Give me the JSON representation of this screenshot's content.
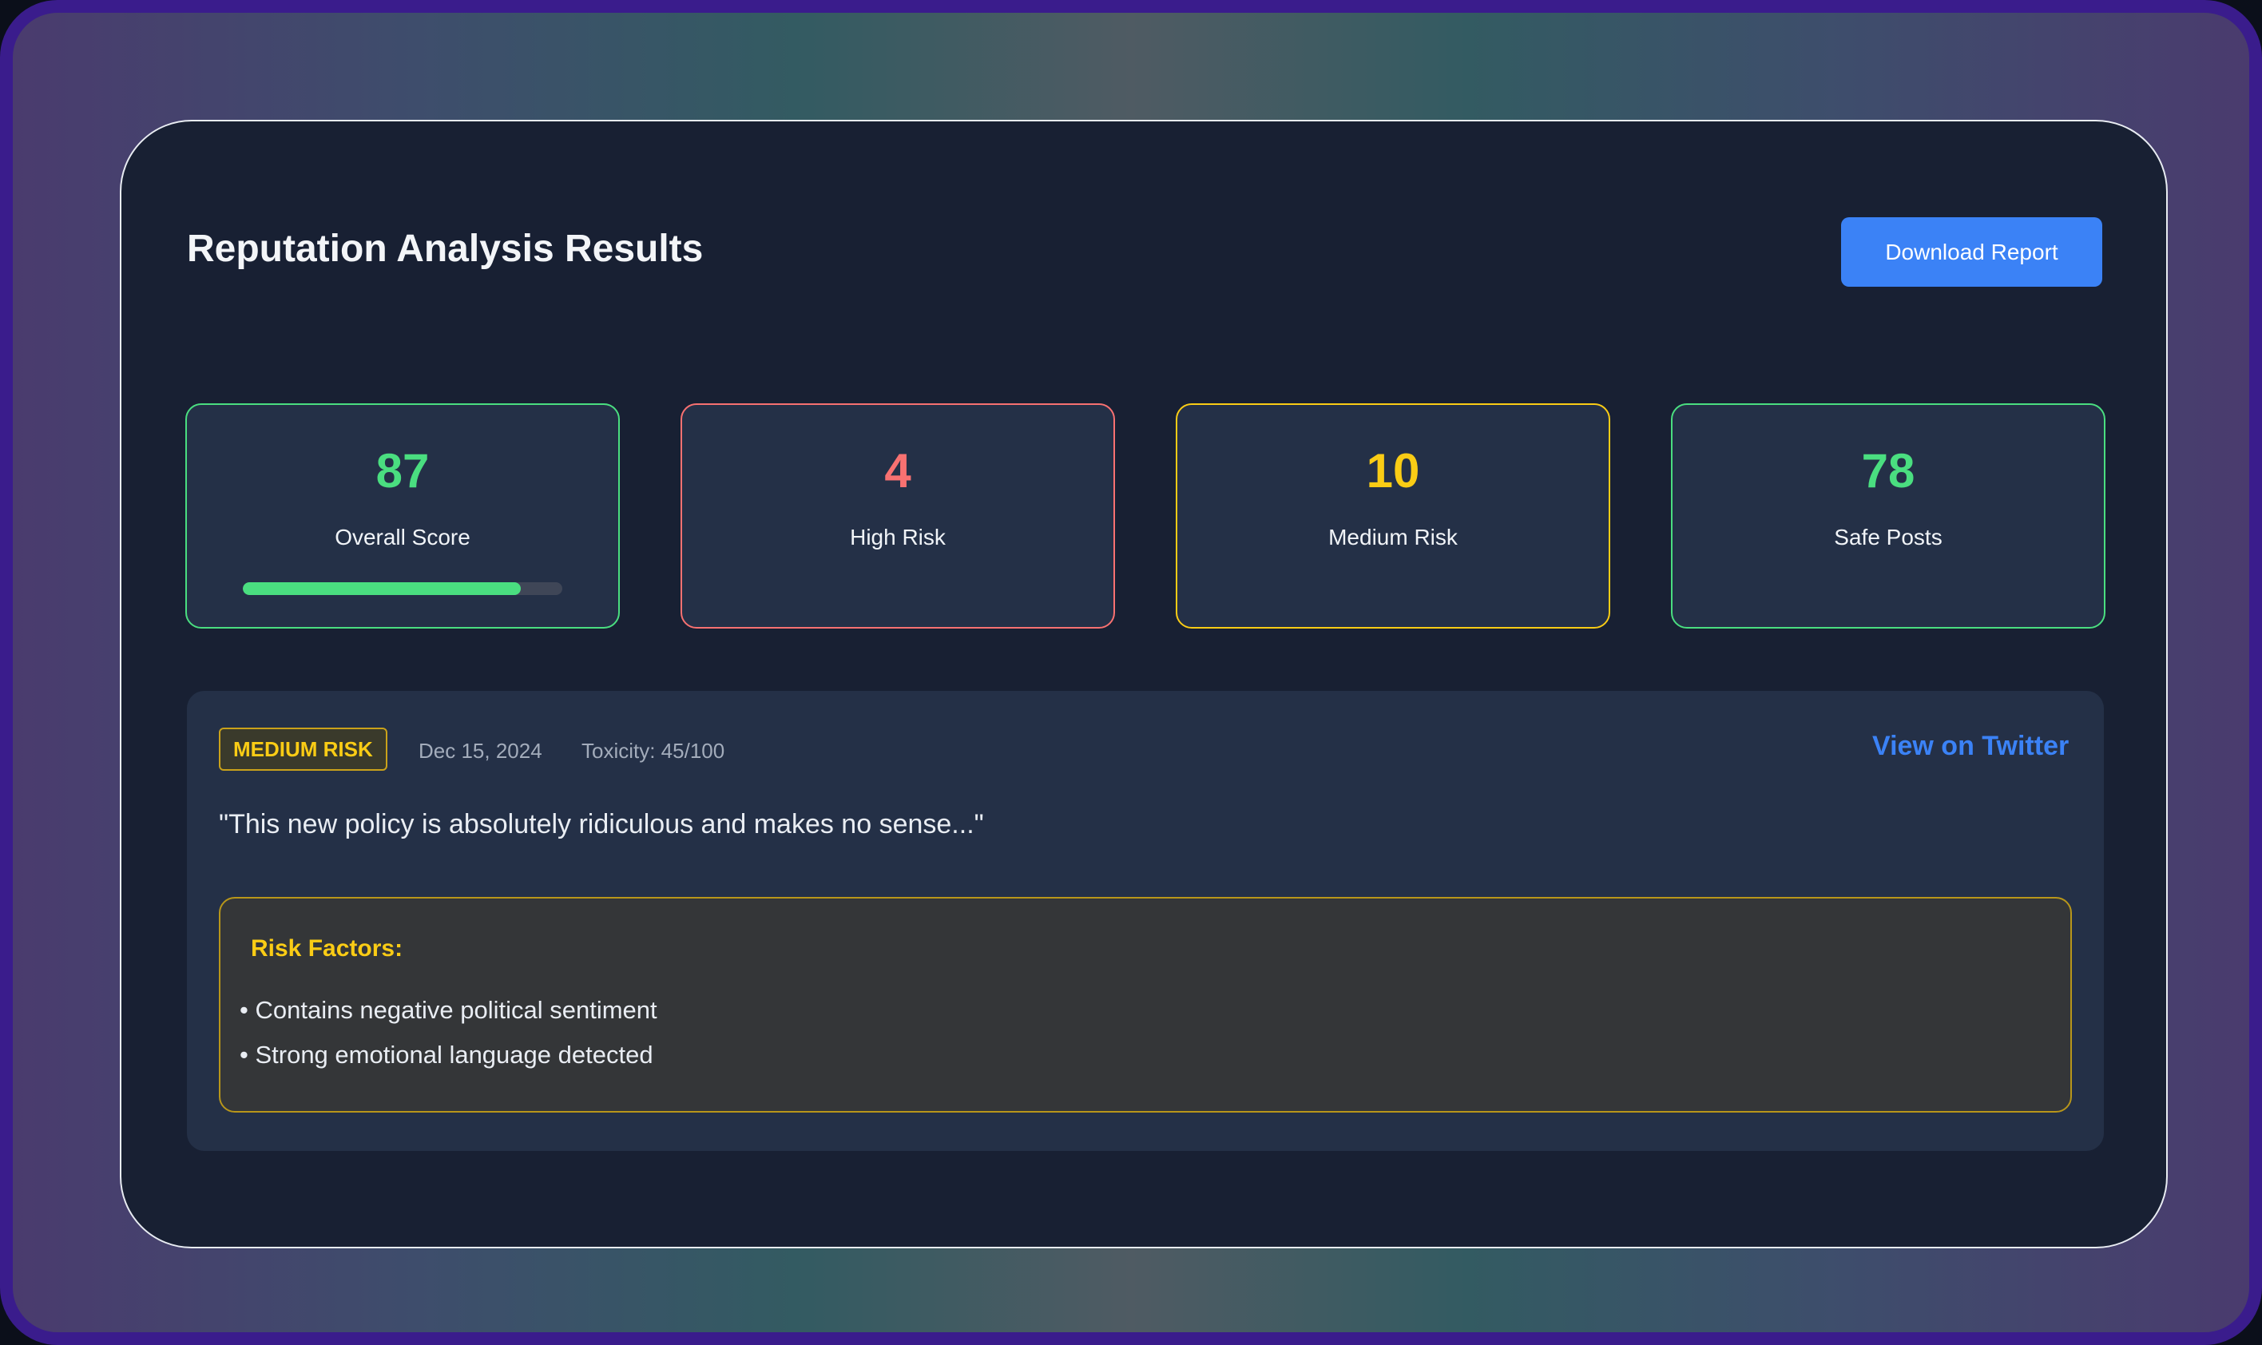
{
  "header": {
    "title": "Reputation Analysis Results",
    "download_label": "Download Report"
  },
  "stats": {
    "overall": {
      "value": "87",
      "label": "Overall Score",
      "progress_percent": 87
    },
    "high": {
      "value": "4",
      "label": "High Risk"
    },
    "medium": {
      "value": "10",
      "label": "Medium Risk"
    },
    "safe": {
      "value": "78",
      "label": "Safe Posts"
    }
  },
  "post": {
    "badge": "MEDIUM RISK",
    "date": "Dec 15, 2024",
    "toxicity": "Toxicity: 45/100",
    "link_label": "View on Twitter",
    "quote": "\"This new policy is absolutely ridiculous and makes no sense...\"",
    "risk_title": "Risk Factors:",
    "risk_factors": [
      "• Contains negative political sentiment",
      "• Strong emotional language detected"
    ]
  },
  "colors": {
    "accent_blue": "#3b82f6",
    "safe_green": "#4ade80",
    "high_red": "#f87171",
    "medium_yellow": "#facc15"
  }
}
